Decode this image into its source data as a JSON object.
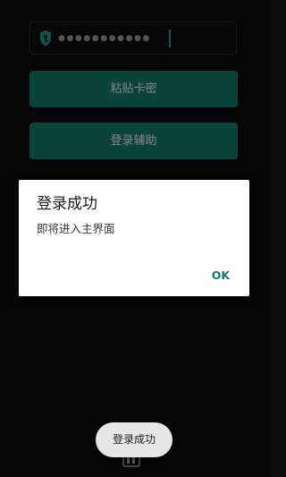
{
  "login_form": {
    "password_mask": "●●●●●●●●●●●",
    "paste_button_label": "粘贴卡密",
    "login_button_label": "登录辅助"
  },
  "dialog": {
    "title": "登录成功",
    "message": "即将进入主界面",
    "ok_label": "OK"
  },
  "toast": {
    "message": "登录成功"
  },
  "colors": {
    "accent": "#117a6c",
    "background": "#0b0b0b"
  },
  "icons": {
    "field_icon": "key-icon"
  }
}
